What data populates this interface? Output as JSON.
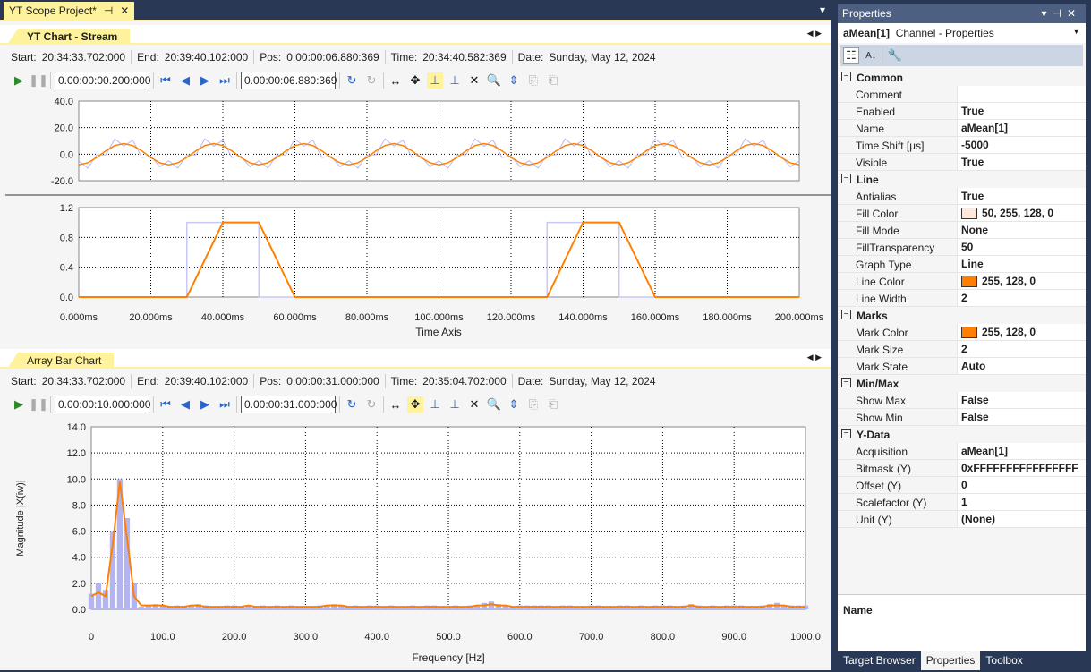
{
  "document": {
    "tab_title": "YT Scope Project*",
    "pin": "⊣",
    "close": "✕",
    "dropdown": "▾"
  },
  "yt_section": {
    "tab": "YT Chart - Stream",
    "info": [
      {
        "k": "Start:",
        "v": "20:34:33.702:000"
      },
      {
        "k": "End:",
        "v": "20:39:40.102:000"
      },
      {
        "k": "Pos:",
        "v": "0.00:00:06.880:369"
      },
      {
        "k": "Time:",
        "v": "20:34:40.582:369"
      },
      {
        "k": "Date:",
        "v": "Sunday, May 12, 2024"
      }
    ],
    "interval": "0.00:00:00.200:000",
    "position": "0.00:00:06.880:369"
  },
  "bar_section": {
    "tab": "Array Bar Chart",
    "info": [
      {
        "k": "Start:",
        "v": "20:34:33.702:000"
      },
      {
        "k": "End:",
        "v": "20:39:40.102:000"
      },
      {
        "k": "Pos:",
        "v": "0.00:00:31.000:000"
      },
      {
        "k": "Time:",
        "v": "20:35:04.702:000"
      },
      {
        "k": "Date:",
        "v": "Sunday, May 12, 2024"
      }
    ],
    "interval": "0.00:00:10.000:000",
    "position": "0.00:00:31.000:000"
  },
  "chart_data": [
    {
      "type": "line",
      "xlim": [
        0,
        200
      ],
      "ylim": [
        -20,
        40
      ],
      "yticks": [
        "40.0",
        "20.0",
        "0.0",
        "-20.0"
      ],
      "grid": true,
      "colors": {
        "raw": "#b8b8f0",
        "mean": "#ff8000"
      },
      "x_step": 2.5,
      "raw": [
        -5,
        -10.5,
        -0.5,
        -0.5,
        11.5,
        6,
        10.5,
        -2.5,
        -1.5,
        -9.5,
        -5,
        -10.5,
        -0.5,
        -0.5,
        11.5,
        6,
        10.5,
        -2.5,
        -1.5,
        -9.5,
        -5,
        -10.5,
        -0.5,
        -0.5,
        11.5,
        6,
        10.5,
        -2.5,
        -1.5,
        -9.5,
        -5,
        -10.5,
        -0.5,
        -0.5,
        11.5,
        6,
        10.5,
        -2.5,
        -1.5,
        -9.5,
        -5,
        -10.5,
        -0.5,
        -0.5,
        11.5,
        6,
        10.5,
        -2.5,
        -1.5,
        -9.5,
        -5,
        -10.5,
        -0.5,
        -0.5,
        11.5,
        6,
        10.5,
        -2.5,
        -1.5,
        -9.5,
        -5,
        -10.5,
        -0.5,
        -0.5,
        11.5,
        6,
        10.5,
        -2.5,
        -1.5,
        -9.5,
        -5,
        -10.5,
        -0.5,
        -0.5,
        11.5,
        6,
        10.5,
        -2.5,
        -1.5,
        -9.5,
        -5
      ],
      "mean": [
        -8,
        -6.5,
        -2.5,
        2.5,
        6.5,
        8,
        6.5,
        2.5,
        -2.5,
        -6.5,
        -8,
        -6.5,
        -2.5,
        2.5,
        6.5,
        8,
        6.5,
        2.5,
        -2.5,
        -6.5,
        -8,
        -6.5,
        -2.5,
        2.5,
        6.5,
        8,
        6.5,
        2.5,
        -2.5,
        -6.5,
        -8,
        -6.5,
        -2.5,
        2.5,
        6.5,
        8,
        6.5,
        2.5,
        -2.5,
        -6.5,
        -8,
        -6.5,
        -2.5,
        2.5,
        6.5,
        8,
        6.5,
        2.5,
        -2.5,
        -6.5,
        -8,
        -6.5,
        -2.5,
        2.5,
        6.5,
        8,
        6.5,
        2.5,
        -2.5,
        -6.5,
        -8,
        -6.5,
        -2.5,
        2.5,
        6.5,
        8,
        6.5,
        2.5,
        -2.5,
        -6.5,
        -8,
        -6.5,
        -2.5,
        2.5,
        6.5,
        8,
        6.5,
        2.5,
        -2.5,
        -6.5,
        -8
      ]
    },
    {
      "type": "line",
      "xlim": [
        0,
        200
      ],
      "ylim": [
        0,
        1.2
      ],
      "yticks": [
        "1.2",
        "0.8",
        "0.4",
        "0.0"
      ],
      "grid": true,
      "xticks": [
        "0.000ms",
        "20.000ms",
        "40.000ms",
        "60.000ms",
        "80.000ms",
        "100.000ms",
        "120.000ms",
        "140.000ms",
        "160.000ms",
        "180.000ms",
        "200.000ms"
      ],
      "xlabel": "Time Axis",
      "square": [
        [
          0,
          0
        ],
        [
          30,
          0
        ],
        [
          30,
          1
        ],
        [
          50,
          1
        ],
        [
          50,
          0
        ],
        [
          130,
          0
        ],
        [
          130,
          1
        ],
        [
          150,
          1
        ],
        [
          150,
          0
        ],
        [
          200,
          0
        ]
      ],
      "trapezoid": [
        [
          0,
          0
        ],
        [
          30,
          0
        ],
        [
          40,
          1
        ],
        [
          50,
          1
        ],
        [
          60,
          0
        ],
        [
          130,
          0
        ],
        [
          140,
          1
        ],
        [
          150,
          1
        ],
        [
          160,
          0
        ],
        [
          200,
          0
        ]
      ],
      "colors": {
        "square": "#c8c8f8",
        "trapezoid": "#ff8000"
      }
    },
    {
      "type": "bar",
      "xlim": [
        0,
        1000
      ],
      "ylim": [
        0,
        14
      ],
      "bar_step": 10,
      "yticks": [
        "14.0",
        "12.0",
        "10.0",
        "8.0",
        "6.0",
        "4.0",
        "2.0",
        "0.0"
      ],
      "xticks": [
        "0",
        "100.0",
        "200.0",
        "300.0",
        "400.0",
        "500.0",
        "600.0",
        "700.0",
        "800.0",
        "900.0",
        "1000.0"
      ],
      "xlabel": "Frequency [Hz]",
      "ylabel": "Magnitude |X(iw)|",
      "colors": {
        "bar": "#b4b4f0",
        "line": "#ff8000"
      },
      "bars": [
        1.2,
        2,
        1.5,
        6,
        10,
        7,
        2,
        0.2,
        0.3,
        0.4,
        0.3,
        0.2,
        0.3,
        0.2,
        0.3,
        0.4,
        0.3,
        0.2,
        0.2,
        0.3,
        0.3,
        0.2,
        0.3,
        0.2,
        0.3,
        0.2,
        0.3,
        0.2,
        0.3,
        0.2,
        0.2,
        0.2,
        0.3,
        0.3,
        0.4,
        0.3,
        0.2,
        0.3,
        0.2,
        0.3,
        0.3,
        0.2,
        0.3,
        0.2,
        0.2,
        0.3,
        0.2,
        0.3,
        0.3,
        0.2,
        0.2,
        0.3,
        0.2,
        0.3,
        0.3,
        0.5,
        0.6,
        0.4,
        0.3,
        0.2,
        0.3,
        0.3,
        0.3,
        0.3,
        0.3,
        0.2,
        0.3,
        0.3,
        0.2,
        0.2,
        0.3,
        0.3,
        0.2,
        0.2,
        0.3,
        0.3,
        0.2,
        0.3,
        0.2,
        0.3,
        0.3,
        0.3,
        0.2,
        0.3,
        0.4,
        0.3,
        0.2,
        0.3,
        0.2,
        0.3,
        0.3,
        0.3,
        0.2,
        0.2,
        0.3,
        0.4,
        0.5,
        0.3,
        0.3,
        0.3,
        0.3
      ],
      "line": [
        1,
        1.3,
        1,
        5,
        9.8,
        5.5,
        1,
        0.3,
        0.3,
        0.3,
        0.3,
        0.2,
        0.2,
        0.2,
        0.3,
        0.3,
        0.2,
        0.2,
        0.2,
        0.2,
        0.2,
        0.2,
        0.3,
        0.2,
        0.2,
        0.2,
        0.2,
        0.2,
        0.2,
        0.2,
        0.2,
        0.2,
        0.2,
        0.3,
        0.3,
        0.3,
        0.2,
        0.2,
        0.2,
        0.2,
        0.2,
        0.2,
        0.2,
        0.2,
        0.2,
        0.2,
        0.2,
        0.2,
        0.2,
        0.2,
        0.2,
        0.2,
        0.2,
        0.2,
        0.3,
        0.3,
        0.4,
        0.3,
        0.3,
        0.2,
        0.2,
        0.2,
        0.2,
        0.2,
        0.2,
        0.2,
        0.2,
        0.2,
        0.2,
        0.2,
        0.2,
        0.2,
        0.2,
        0.2,
        0.2,
        0.2,
        0.2,
        0.2,
        0.2,
        0.2,
        0.2,
        0.2,
        0.2,
        0.2,
        0.3,
        0.2,
        0.2,
        0.2,
        0.2,
        0.2,
        0.2,
        0.2,
        0.2,
        0.2,
        0.2,
        0.3,
        0.3,
        0.3,
        0.2,
        0.2,
        0.2
      ]
    }
  ],
  "properties": {
    "title": "Properties",
    "header_bold": "aMean[1]",
    "header_rest": "Channel - Properties",
    "categories": [
      {
        "name": "Common",
        "rows": [
          {
            "n": "Comment",
            "v": ""
          },
          {
            "n": "Enabled",
            "v": "True"
          },
          {
            "n": "Name",
            "v": "aMean[1]"
          },
          {
            "n": "Time Shift [µs]",
            "v": "-5000"
          },
          {
            "n": "Visible",
            "v": "True"
          }
        ]
      },
      {
        "name": "Line",
        "rows": [
          {
            "n": "Antialias",
            "v": "True"
          },
          {
            "n": "Fill Color",
            "v": "50, 255, 128, 0",
            "swatch": "#ffe8d8"
          },
          {
            "n": "Fill Mode",
            "v": "None"
          },
          {
            "n": "FillTransparency",
            "v": "50"
          },
          {
            "n": "Graph Type",
            "v": "Line"
          },
          {
            "n": "Line Color",
            "v": "255, 128, 0",
            "swatch": "#ff8000"
          },
          {
            "n": "Line Width",
            "v": "2"
          }
        ]
      },
      {
        "name": "Marks",
        "rows": [
          {
            "n": "Mark Color",
            "v": "255, 128, 0",
            "swatch": "#ff8000"
          },
          {
            "n": "Mark Size",
            "v": "2"
          },
          {
            "n": "Mark State",
            "v": "Auto"
          }
        ]
      },
      {
        "name": "Min/Max",
        "rows": [
          {
            "n": "Show Max",
            "v": "False"
          },
          {
            "n": "Show Min",
            "v": "False"
          }
        ]
      },
      {
        "name": "Y-Data",
        "rows": [
          {
            "n": "Acquisition",
            "v": "aMean[1]"
          },
          {
            "n": "Bitmask (Y)",
            "v": "0xFFFFFFFFFFFFFFFF"
          },
          {
            "n": "Offset (Y)",
            "v": "0"
          },
          {
            "n": "Scalefactor (Y)",
            "v": "1"
          },
          {
            "n": "Unit (Y)",
            "v": "(None)"
          }
        ]
      }
    ],
    "description_title": "Name"
  },
  "bottom_tabs": [
    {
      "label": "Target Browser",
      "active": false
    },
    {
      "label": "Properties",
      "active": true
    },
    {
      "label": "Toolbox",
      "active": false
    }
  ]
}
